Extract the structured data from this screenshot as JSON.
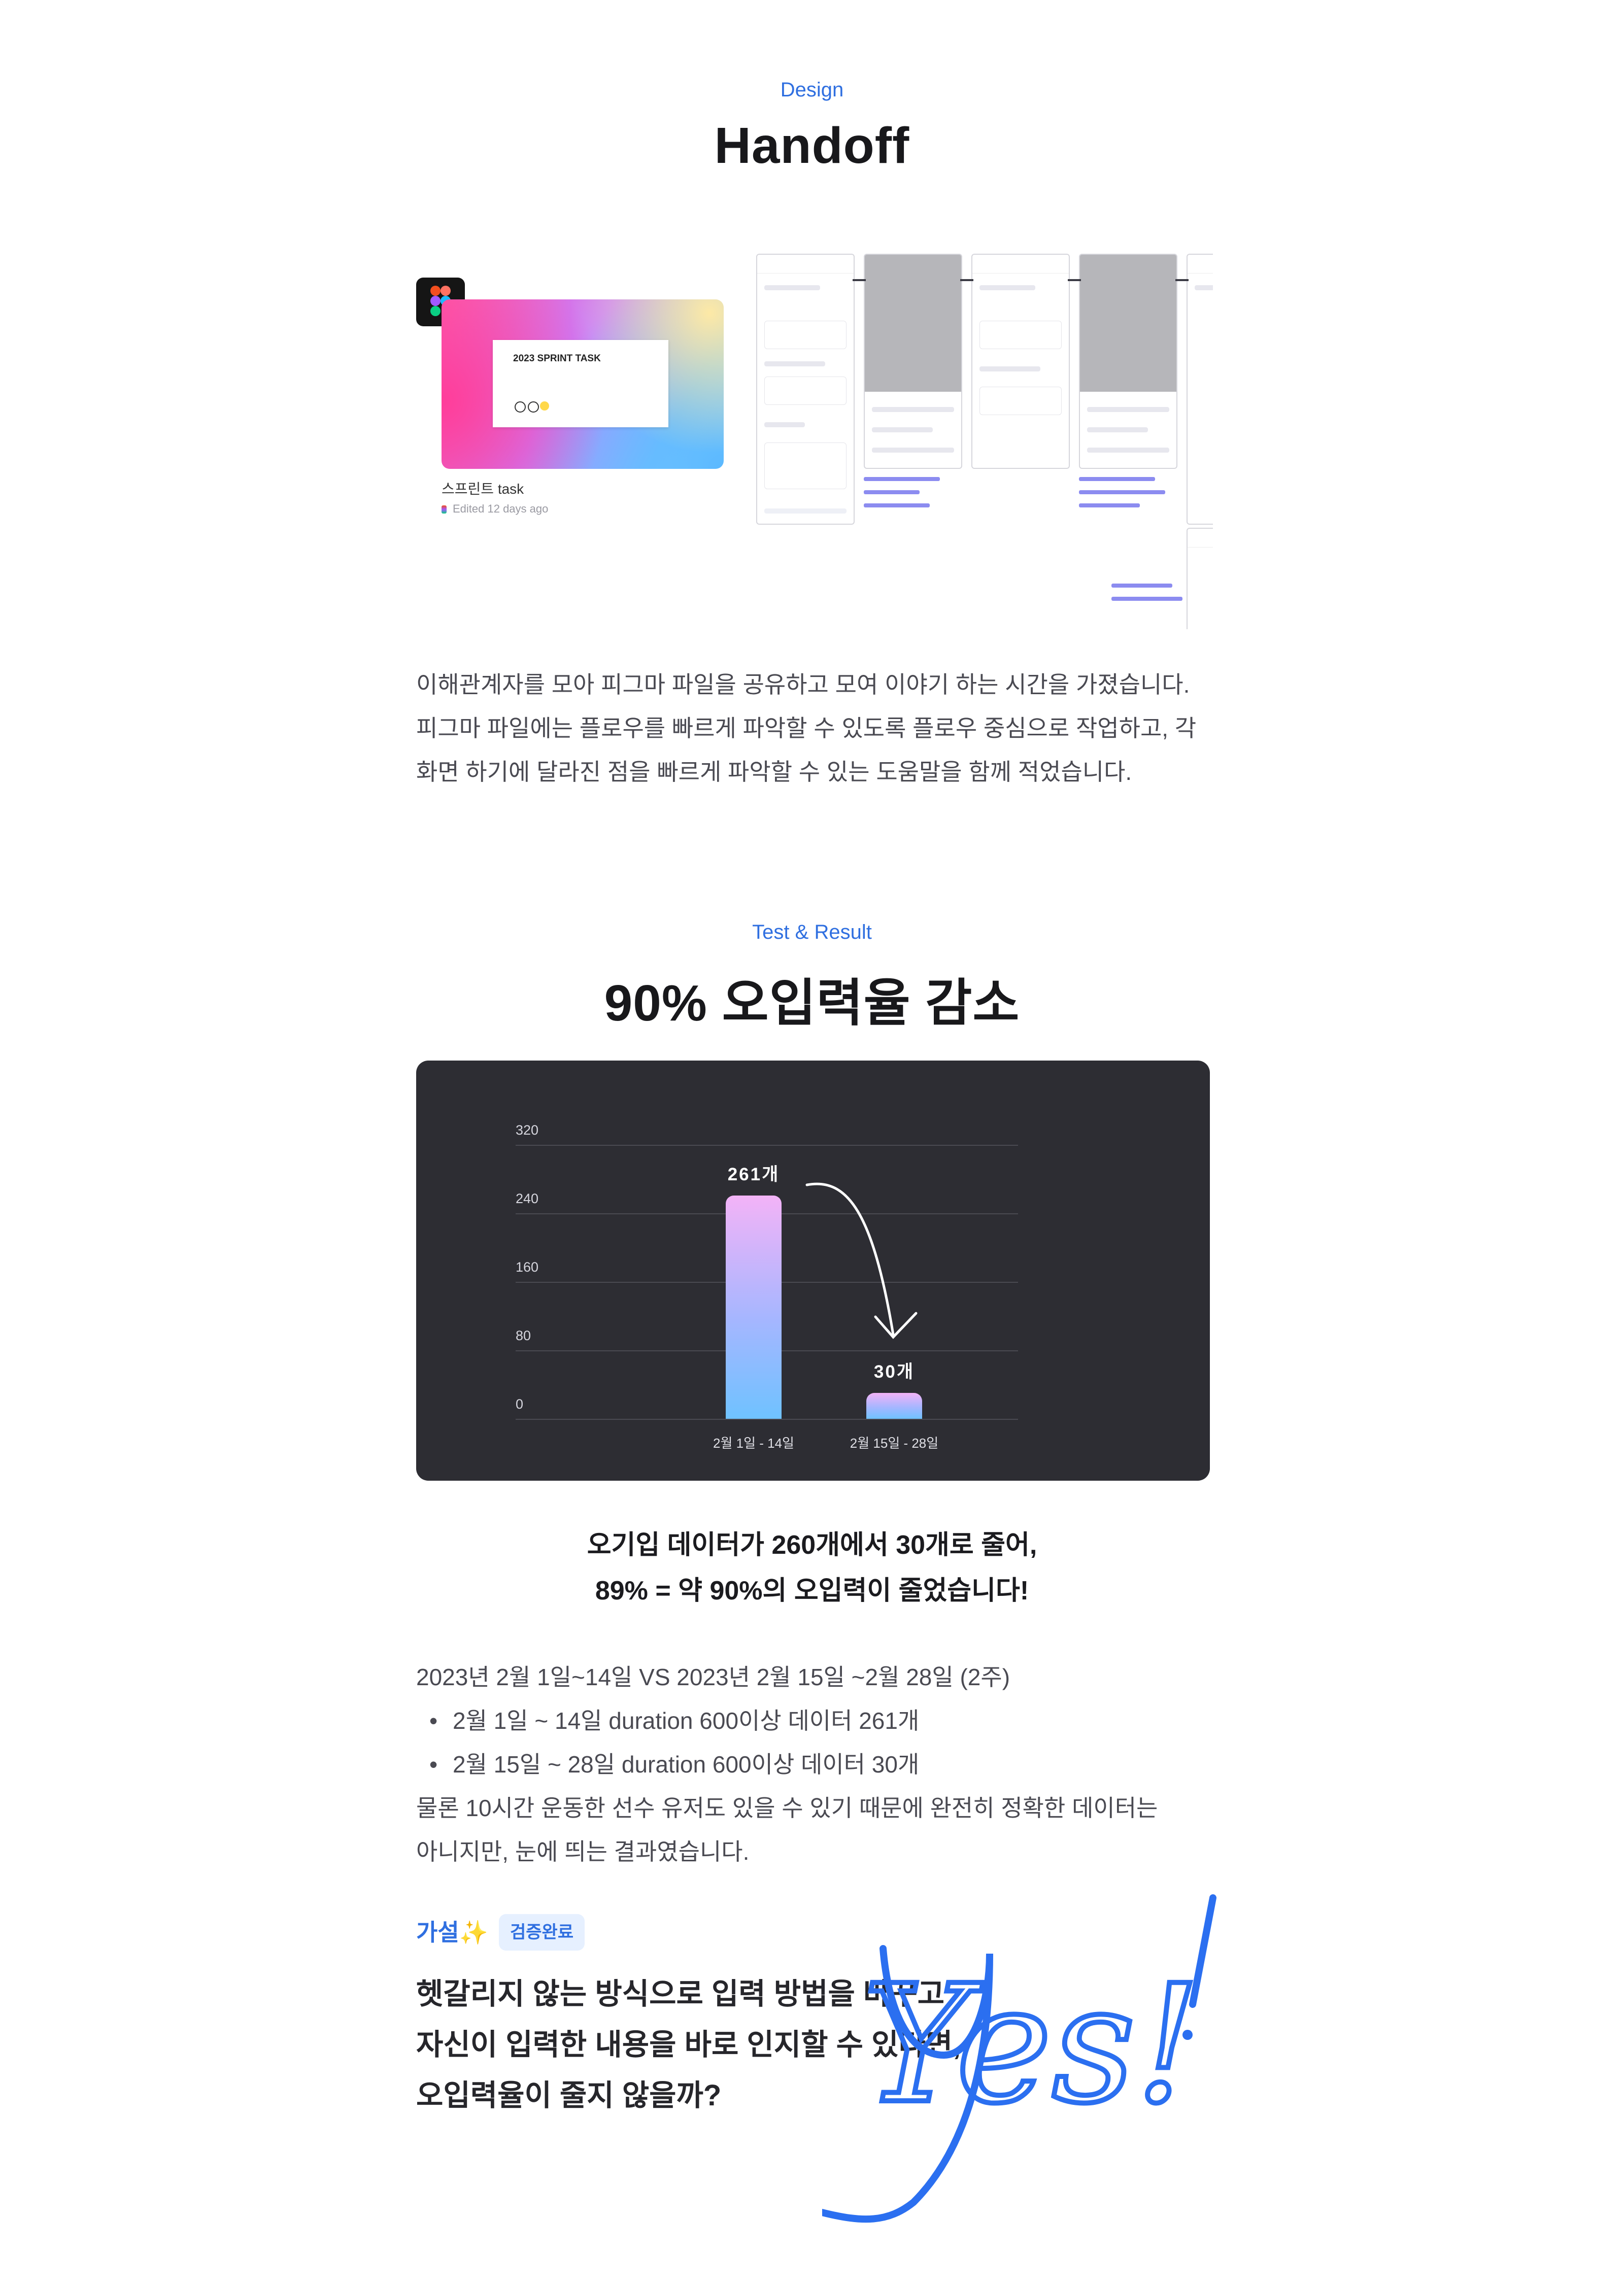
{
  "handoff": {
    "eyebrow": "Design",
    "title": "Handoff",
    "thumbnail_title": "2023 SPRINT TASK",
    "file_name": "스프린트 task",
    "file_meta": "Edited 12 days ago",
    "paragraph": [
      "이해관계자를 모아 피그마 파일을 공유하고 모여 이야기 하는 시간을 가졌습니다.",
      "피그마 파일에는 플로우를 빠르게 파악할 수 있도록 플로우 중심으로 작업하고, 각",
      "화면 하기에 달라진 점을 빠르게 파악할 수 있는 도움말을 함께 적었습니다."
    ]
  },
  "result": {
    "eyebrow": "Test & Result",
    "title": "90% 오입력율 감소",
    "conclusion": [
      "오기입 데이터가 260개에서 30개로 줄어,",
      "89% = 약 90%의 오입력이 줄었습니다!"
    ],
    "period": "2023년 2월 1일~14일 VS 2023년 2월 15일 ~2월 28일 (2주)",
    "bullets": [
      "2월 1일 ~ 14일 duration 600이상 데이터 261개",
      "2월 15일 ~ 28일 duration 600이상 데이터 30개"
    ],
    "note": [
      "물론 10시간 운동한 선수 유저도 있을 수 있기 때문에 완전히 정확한 데이터는",
      "아니지만, 눈에 띄는 결과였습니다."
    ]
  },
  "chart_data": {
    "type": "bar",
    "categories": [
      "2월 1일 - 14일",
      "2월 15일 - 28일"
    ],
    "values": [
      261,
      30
    ],
    "data_labels": [
      "261개",
      "30개"
    ],
    "yticks": [
      "0",
      "80",
      "160",
      "240",
      "320"
    ],
    "ylim": [
      0,
      320
    ],
    "grid": true,
    "colors": {
      "background": "#2d2d33",
      "bar_top": "#f3b3f7",
      "bar_bottom": "#6fc2ff"
    }
  },
  "hypothesis": {
    "label": "가설",
    "sparkle": "✨",
    "badge": "검증완료",
    "question": [
      "헷갈리지 않는 방식으로 입력 방법을 바꾸고",
      "자신이 입력한 내용을 바로 인지할 수 있다면,",
      "오입력율이 줄지 않을까?"
    ],
    "handwriting": "Yes!"
  },
  "colors": {
    "accent": "#2f6fe0",
    "badge_bg": "#e6f0ff",
    "text": "#4a4a52"
  }
}
